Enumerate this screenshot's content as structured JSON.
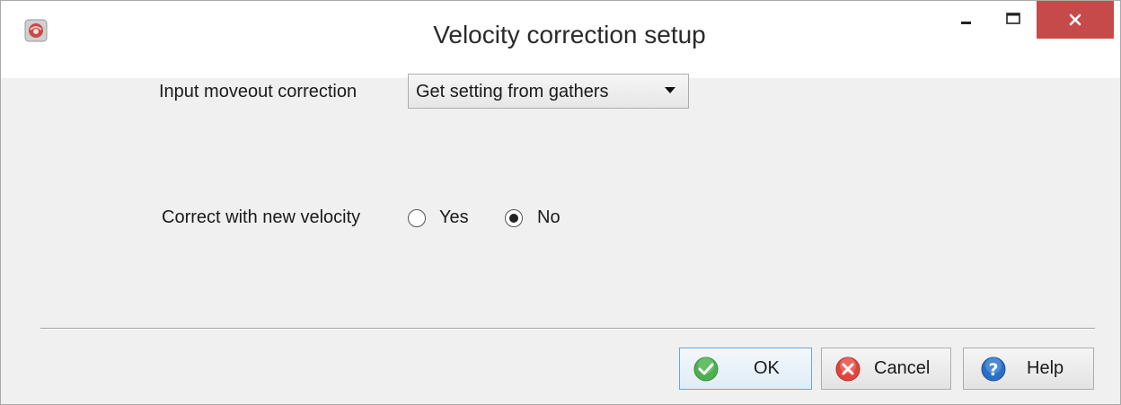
{
  "window": {
    "title": "Velocity correction setup"
  },
  "form": {
    "moveout_label": "Input moveout correction",
    "moveout_value": "Get setting from gathers",
    "velocity_label": "Correct with new velocity",
    "options": [
      {
        "label": "Yes",
        "selected": false
      },
      {
        "label": "No",
        "selected": true
      }
    ]
  },
  "buttons": {
    "ok": "OK",
    "cancel": "Cancel",
    "help": "Help"
  },
  "colors": {
    "close_button": "#c74a4a",
    "ok_icon": "#4caf50",
    "cancel_icon": "#e0453c",
    "help_icon": "#2b6fc4"
  },
  "icons": {
    "app": "app-logo-icon",
    "minimize": "minimize-icon",
    "maximize": "maximize-icon",
    "close": "close-icon",
    "ok": "checkmark-icon",
    "cancel": "cancel-x-icon",
    "help": "question-icon"
  }
}
